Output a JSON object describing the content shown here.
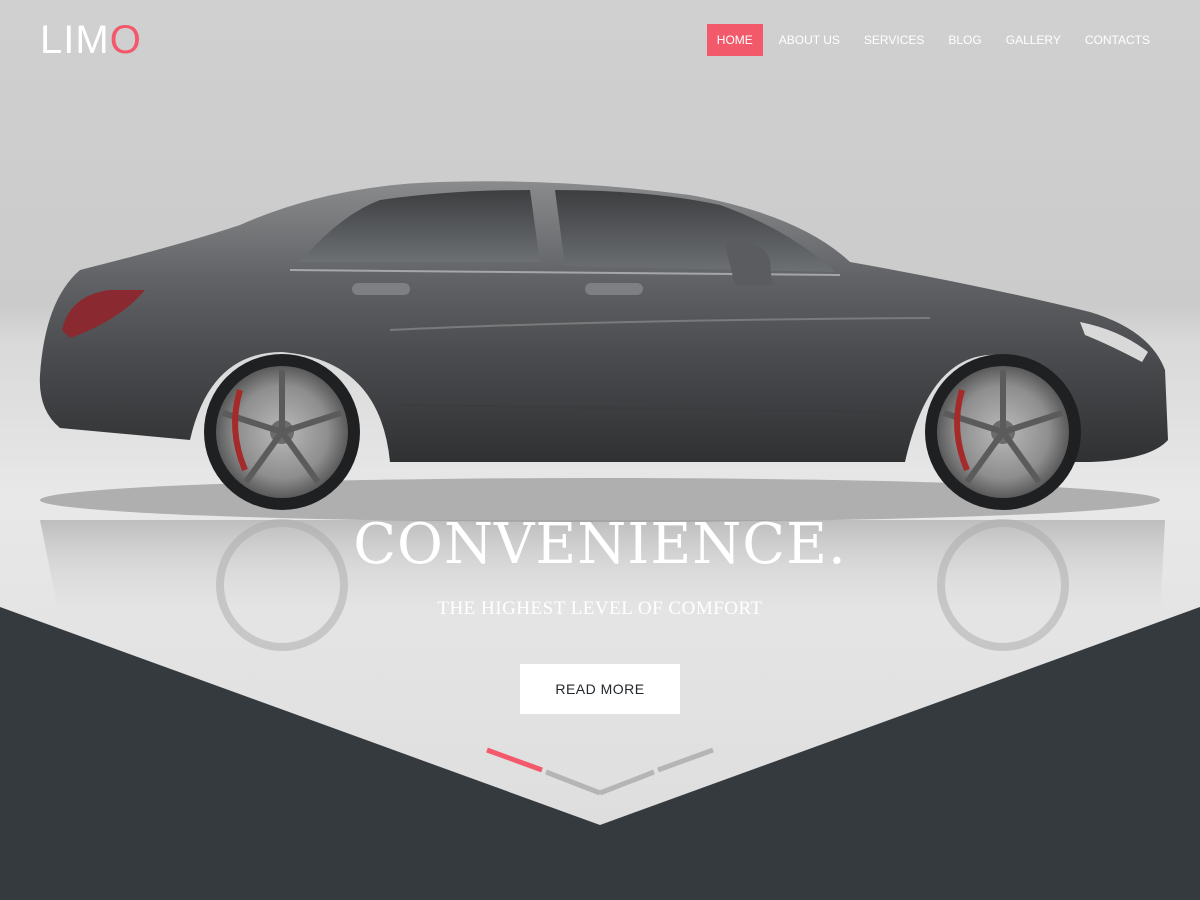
{
  "brand": {
    "logo_prefix": "LIM",
    "logo_accent": "O",
    "accent_color": "#f2596a"
  },
  "nav": {
    "items": [
      {
        "label": "HOME",
        "active": true
      },
      {
        "label": "ABOUT US",
        "active": false
      },
      {
        "label": "SERVICES",
        "active": false
      },
      {
        "label": "BLOG",
        "active": false
      },
      {
        "label": "GALLERY",
        "active": false
      },
      {
        "label": "CONTACTS",
        "active": false
      }
    ]
  },
  "hero": {
    "headline": "CONVENIENCE.",
    "subline": "THE HIGHEST LEVEL OF COMFORT",
    "button_label": "READ MORE",
    "background_image": "gray-sedan-photo",
    "bottom_band_color": "#353a3f"
  },
  "scroll_indicator": {
    "icon": "chevron-down-icon",
    "active_color": "#f2596a",
    "inactive_color": "#b5b5b5"
  }
}
